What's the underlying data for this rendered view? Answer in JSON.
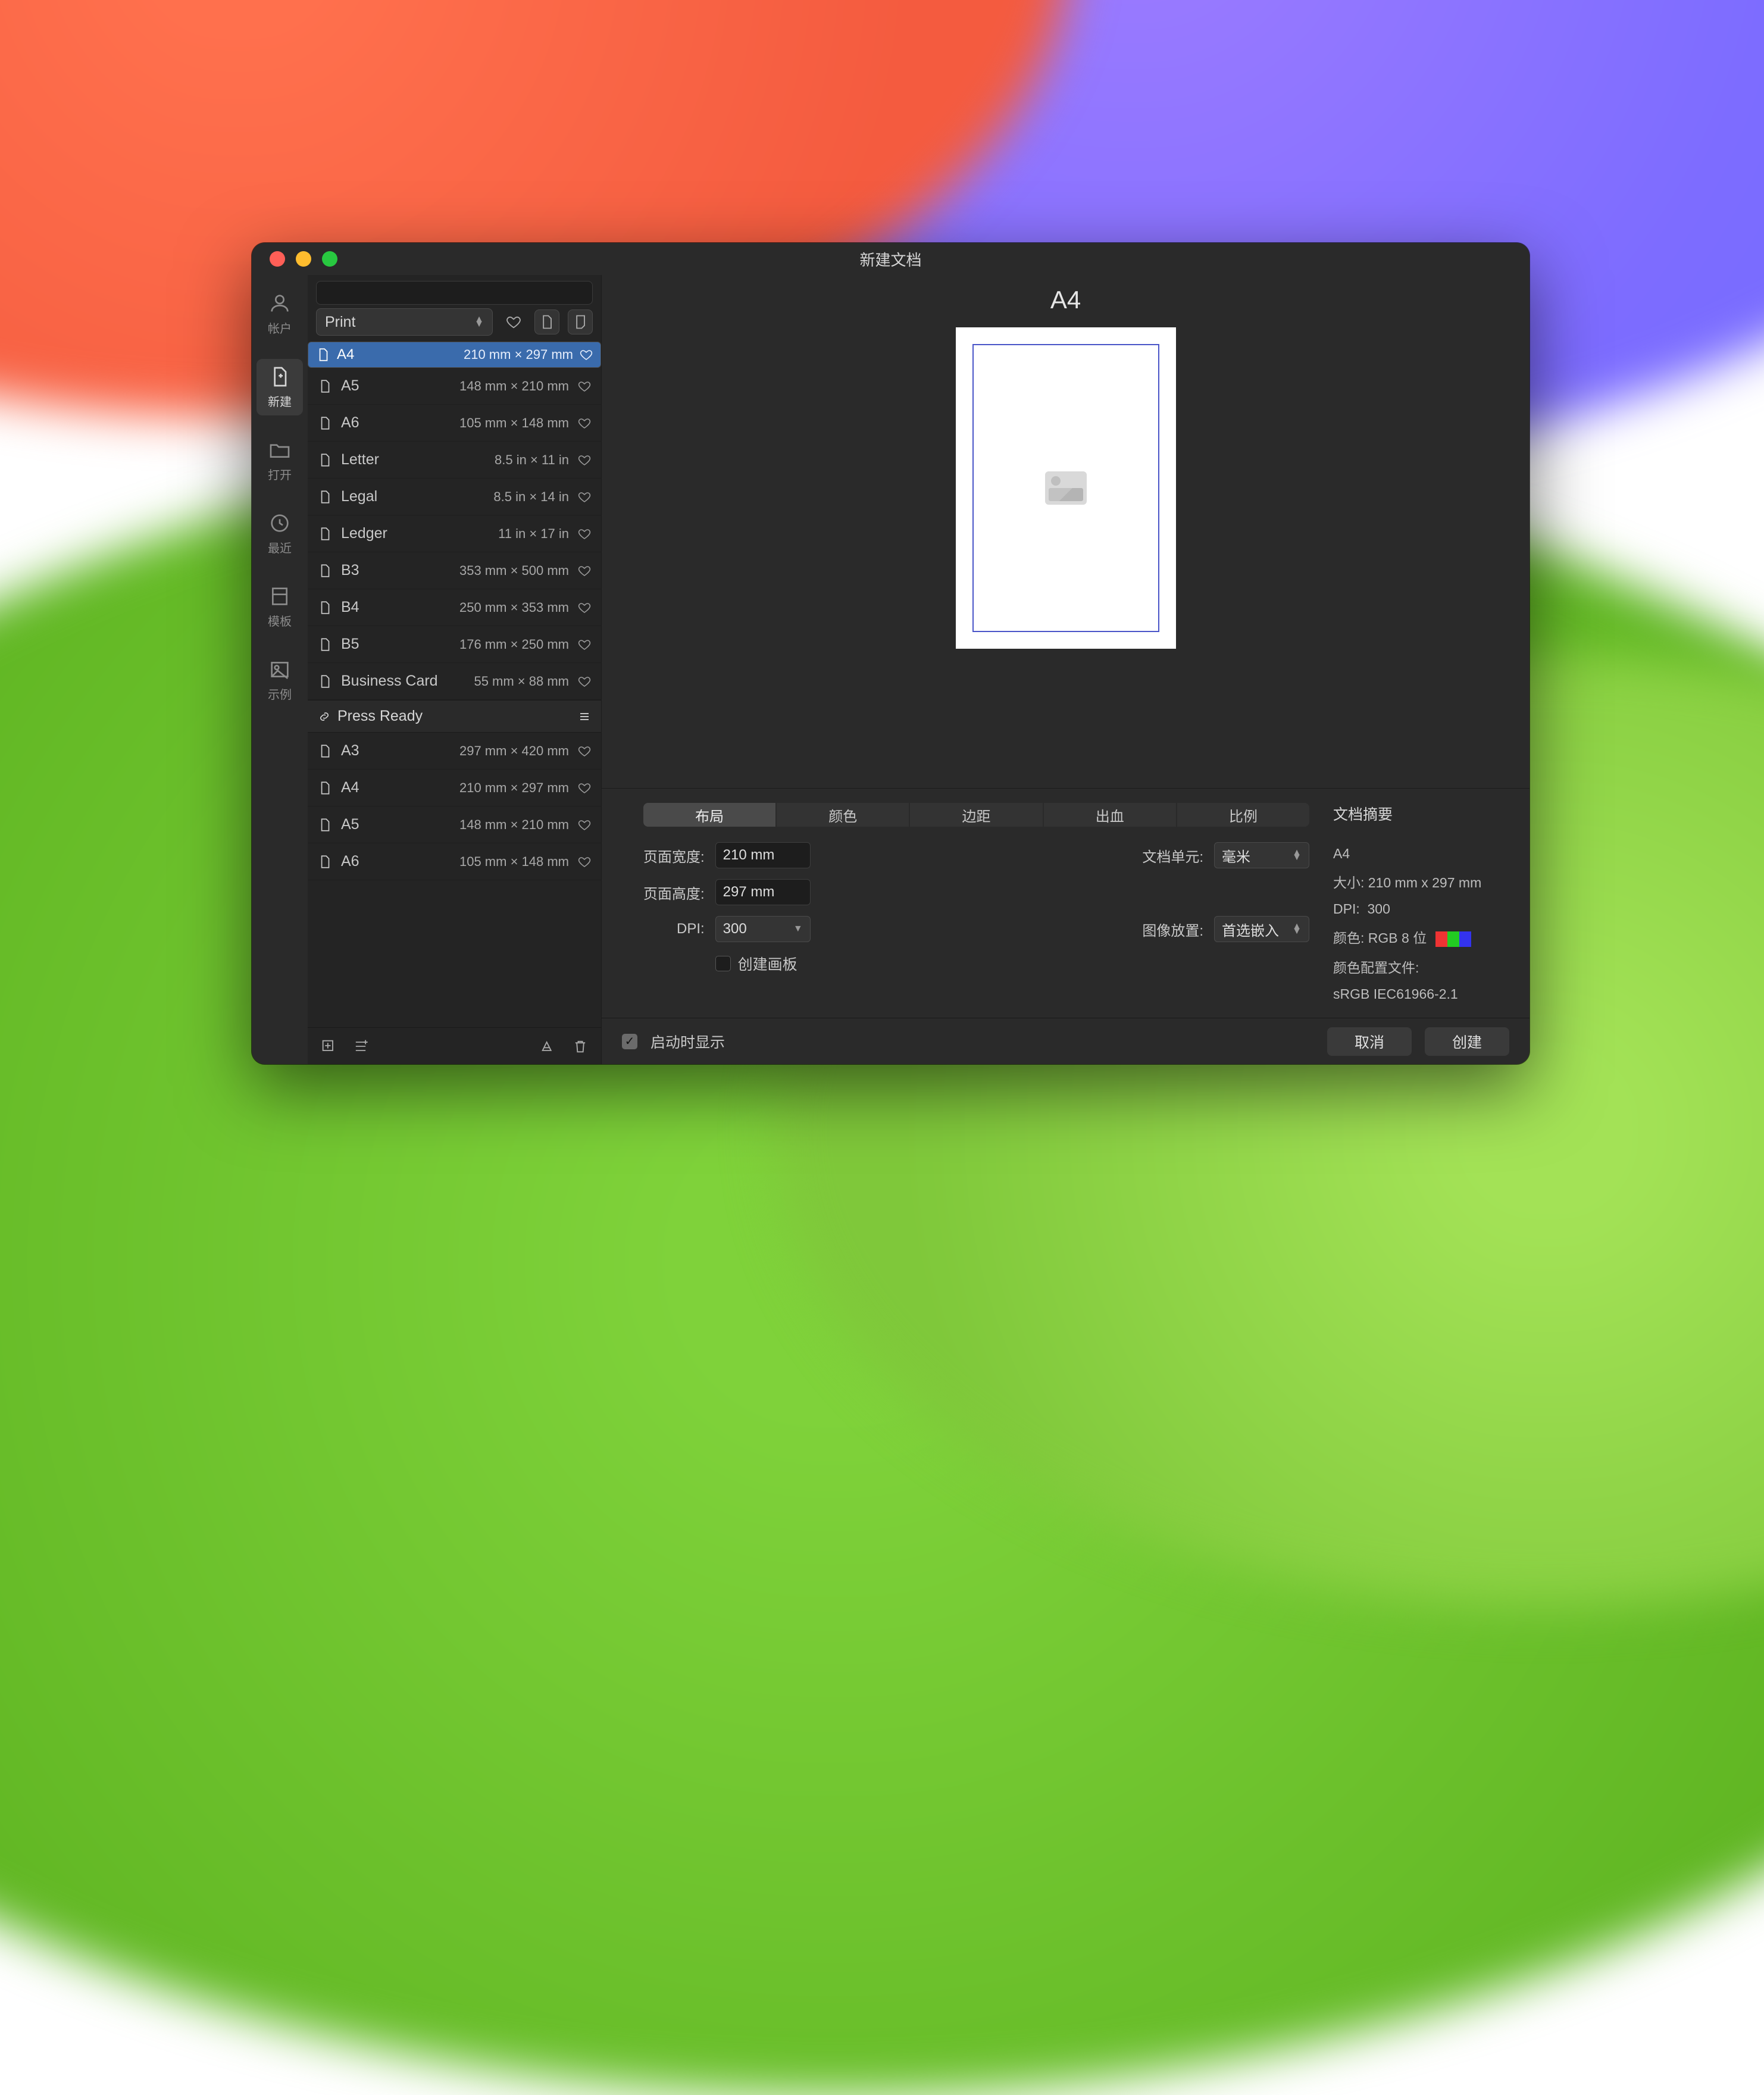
{
  "window": {
    "title": "新建文档"
  },
  "rail": [
    {
      "key": "account",
      "label": "帐户"
    },
    {
      "key": "new",
      "label": "新建",
      "active": true
    },
    {
      "key": "open",
      "label": "打开"
    },
    {
      "key": "recent",
      "label": "最近"
    },
    {
      "key": "template",
      "label": "模板"
    },
    {
      "key": "sample",
      "label": "示例"
    }
  ],
  "search": {
    "placeholder": ""
  },
  "category": {
    "selected": "Print"
  },
  "presets": [
    {
      "name": "A4",
      "dims": "210 mm × 297 mm",
      "selected": true
    },
    {
      "name": "A5",
      "dims": "148 mm × 210 mm"
    },
    {
      "name": "A6",
      "dims": "105 mm × 148 mm"
    },
    {
      "name": "Letter",
      "dims": "8.5 in × 11 in"
    },
    {
      "name": "Legal",
      "dims": "8.5 in × 14 in"
    },
    {
      "name": "Ledger",
      "dims": "11 in × 17 in"
    },
    {
      "name": "B3",
      "dims": "353 mm × 500 mm"
    },
    {
      "name": "B4",
      "dims": "250 mm × 353 mm"
    },
    {
      "name": "B5",
      "dims": "176 mm × 250 mm"
    },
    {
      "name": "Business Card",
      "dims": "55 mm × 88 mm"
    }
  ],
  "group2": {
    "title": "Press Ready",
    "items": [
      {
        "name": "A3",
        "dims": "297 mm × 420 mm"
      },
      {
        "name": "A4",
        "dims": "210 mm × 297 mm"
      },
      {
        "name": "A5",
        "dims": "148 mm × 210 mm"
      },
      {
        "name": "A6",
        "dims": "105 mm × 148 mm"
      }
    ]
  },
  "preview": {
    "title": "A4"
  },
  "tabs": [
    "布局",
    "颜色",
    "边距",
    "出血",
    "比例"
  ],
  "activeTab": 0,
  "form": {
    "width_label": "页面宽度:",
    "width": "210 mm",
    "height_label": "页面高度:",
    "height": "297 mm",
    "dpi_label": "DPI:",
    "dpi": "300",
    "unit_label": "文档单元:",
    "unit": "毫米",
    "place_label": "图像放置:",
    "place": "首选嵌入",
    "artboard_label": "创建画板"
  },
  "summary": {
    "heading": "文档摘要",
    "name": "A4",
    "size_label": "大小:",
    "size": "210 mm x 297 mm",
    "dpi_label": "DPI:",
    "dpi": "300",
    "color_label": "颜色:",
    "color": "RGB 8 位",
    "profile_label": "颜色配置文件:",
    "profile": "sRGB IEC61966-2.1"
  },
  "footer": {
    "startup": "启动时显示",
    "cancel": "取消",
    "create": "创建"
  }
}
